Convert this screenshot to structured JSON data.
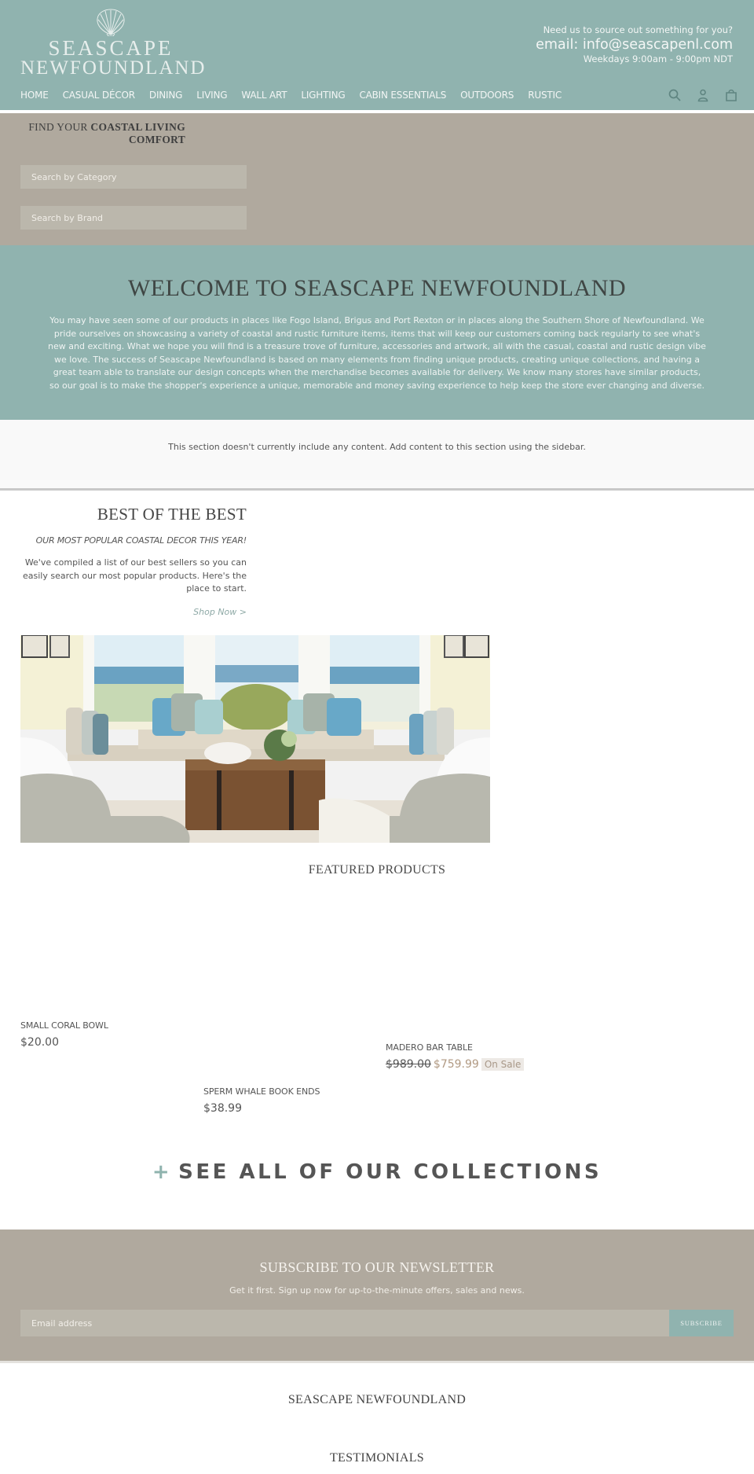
{
  "header": {
    "logo": {
      "line1": "SEASCAPE",
      "line2": "NEWFOUNDLAND",
      "icon": "scallop-shell-icon"
    },
    "contact": {
      "prompt": "Need us to source out something for you?",
      "email": "email: info@seascapenl.com",
      "hours": "Weekdays 9:00am - 9:00pm NDT"
    },
    "nav": [
      {
        "label": "HOME"
      },
      {
        "label": "CASUAL DÉCOR"
      },
      {
        "label": "DINING"
      },
      {
        "label": "LIVING"
      },
      {
        "label": "WALL ART"
      },
      {
        "label": "LIGHTING"
      },
      {
        "label": "CABIN ESSENTIALS"
      },
      {
        "label": "OUTDOORS"
      },
      {
        "label": "RUSTIC"
      }
    ],
    "icons": [
      "search-icon",
      "account-icon",
      "cart-icon"
    ]
  },
  "finder": {
    "title_plain": "FIND YOUR ",
    "title_bold": "COASTAL LIVING COMFORT",
    "category_placeholder": "Search by Category",
    "brand_placeholder": "Search by Brand"
  },
  "welcome": {
    "title": "WELCOME TO SEASCAPE NEWFOUNDLAND",
    "body": "You may have seen some of our products in places like Fogo Island, Brigus and Port Rexton or in places along the Southern Shore of Newfoundland. We pride ourselves on showcasing a variety of coastal and rustic furniture items, items that will keep our customers coming back regularly to see what's new and exciting. What we hope you will find is a treasure trove of furniture, accessories and artwork, all with the casual, coastal and rustic design vibe we love. The success of Seascape Newfoundland is based on many elements from finding unique products, creating unique collections, and having a great team able to translate our design concepts when the merchandise becomes available for delivery. We know many stores have similar products, so our goal is to make the shopper's experience a unique, memorable and money saving experience to help keep the store ever changing and diverse."
  },
  "empty_section": {
    "message": "This section doesn't currently include any content. Add content to this section using the sidebar."
  },
  "best": {
    "title": "BEST OF THE BEST",
    "subtitle": "OUR MOST POPULAR COASTAL DECOR THIS YEAR!",
    "description": "We've compiled a list of our best sellers so you can easily search our most popular products.  Here's the place to start.",
    "link": "Shop Now >",
    "image_alt": "Coastal living room with bay window seating, blue pillows and wooden trunk coffee table"
  },
  "featured": {
    "title": "FEATURED PRODUCTS",
    "products": [
      {
        "name": "SMALL CORAL BOWL",
        "price": "$20.00"
      },
      {
        "name": "MADERO BAR TABLE",
        "old_price": "$989.00",
        "sale_price": "$759.99",
        "badge": "On Sale"
      },
      {
        "name": "SPERM WHALE BOOK ENDS",
        "price": "$38.99"
      }
    ]
  },
  "collections": {
    "plus": "+",
    "label": "SEE ALL OF OUR COLLECTIONS"
  },
  "newsletter": {
    "title": "SUBSCRIBE TO OUR NEWSLETTER",
    "subtitle": "Get it first. Sign up now for up-to-the-minute offers, sales and news.",
    "placeholder": "Email address",
    "button": "SUBSCRIBE"
  },
  "footer": {
    "brand": "SEASCAPE NEWFOUNDLAND",
    "testimonials": "TESTIMONIALS"
  },
  "colors": {
    "teal": "#90b3af",
    "taupe": "#b0a99e",
    "sale": "#b19a83"
  }
}
